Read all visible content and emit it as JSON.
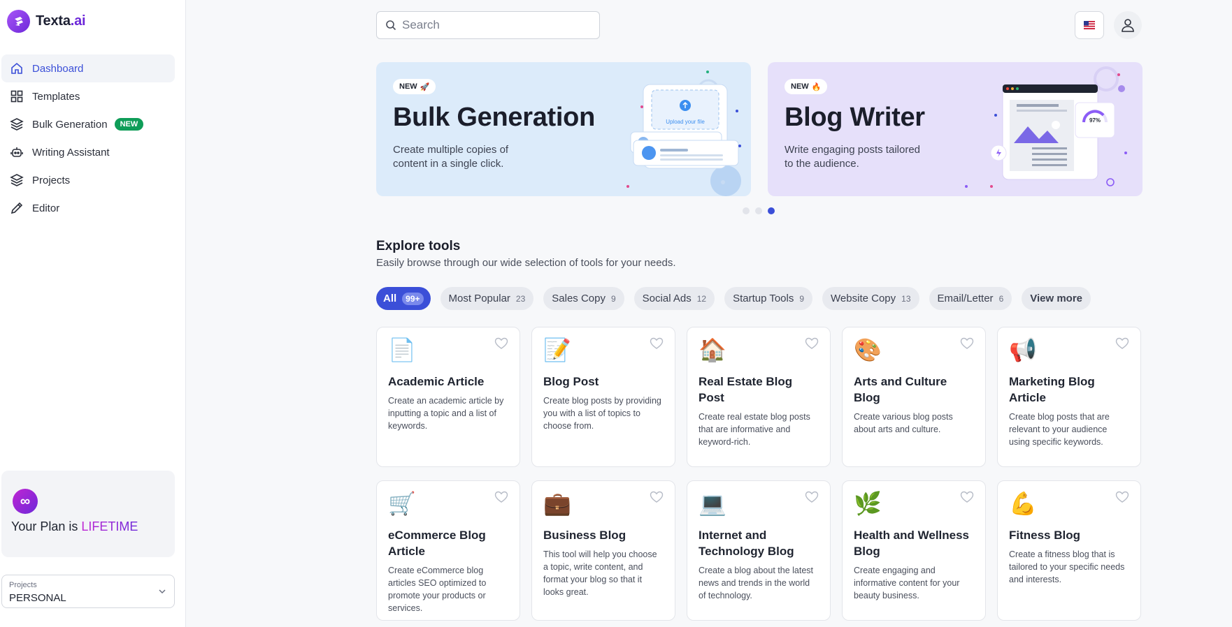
{
  "app": {
    "logo_main": "Texta",
    "logo_suffix": ".ai"
  },
  "sidebar": {
    "items": [
      {
        "label": "Dashboard",
        "icon": "home-icon"
      },
      {
        "label": "Templates",
        "icon": "grid-icon"
      },
      {
        "label": "Bulk Generation",
        "icon": "layers-icon",
        "badge": "NEW"
      },
      {
        "label": "Writing Assistant",
        "icon": "robot-icon"
      },
      {
        "label": "Projects",
        "icon": "layers-icon"
      },
      {
        "label": "Editor",
        "icon": "pencil-icon"
      }
    ],
    "plan": {
      "prefix": "Your Plan is ",
      "value": "LIFETIME"
    },
    "project_select": {
      "label": "Projects",
      "value": "PERSONAL"
    }
  },
  "search": {
    "placeholder": "Search"
  },
  "banners": [
    {
      "pill": "NEW",
      "title": "Bulk Generation",
      "desc": "Create multiple copies of content in a single click.",
      "art_text": "Upload your file"
    },
    {
      "pill": "NEW",
      "title": "Blog Writer",
      "desc": "Write engaging posts tailored to the audience.",
      "art_text": "97%"
    }
  ],
  "carousel": {
    "count": 3,
    "active": 3
  },
  "explore": {
    "title": "Explore tools",
    "subtitle": "Easily browse through our wide selection of tools for your needs.",
    "chips": [
      {
        "label": "All",
        "count": "99+"
      },
      {
        "label": "Most Popular",
        "count": "23"
      },
      {
        "label": "Sales Copy",
        "count": "9"
      },
      {
        "label": "Social Ads",
        "count": "12"
      },
      {
        "label": "Startup Tools",
        "count": "9"
      },
      {
        "label": "Website Copy",
        "count": "13"
      },
      {
        "label": "Email/Letter",
        "count": "6"
      }
    ],
    "view_more": "View more"
  },
  "tools": [
    {
      "emoji": "📄",
      "title": "Academic Article",
      "desc": "Create an academic article by inputting a topic and a list of keywords."
    },
    {
      "emoji": "📝",
      "title": "Blog Post",
      "desc": "Create blog posts by providing you with a list of topics to choose from."
    },
    {
      "emoji": "🏠",
      "title": "Real Estate Blog Post",
      "desc": "Create real estate blog posts that are informative and keyword-rich."
    },
    {
      "emoji": "🎨",
      "title": "Arts and Culture Blog",
      "desc": "Create various blog posts about arts and culture."
    },
    {
      "emoji": "📢",
      "title": "Marketing Blog Article",
      "desc": "Create blog posts that are relevant to your audience using specific keywords."
    },
    {
      "emoji": "🛒",
      "title": "eCommerce Blog Article",
      "desc": "Create eCommerce blog articles SEO optimized to promote your products or services."
    },
    {
      "emoji": "💼",
      "title": "Business Blog",
      "desc": "This tool will help you choose a topic, write content, and format your blog so that it looks great."
    },
    {
      "emoji": "💻",
      "title": "Internet and Technology Blog",
      "desc": "Create a blog about the latest news and trends in the world of technology."
    },
    {
      "emoji": "🌿",
      "title": "Health and Wellness Blog",
      "desc": "Create engaging and informative content for your beauty business."
    },
    {
      "emoji": "💪",
      "title": "Fitness Blog",
      "desc": "Create a fitness blog that is tailored to your specific needs and interests."
    }
  ]
}
